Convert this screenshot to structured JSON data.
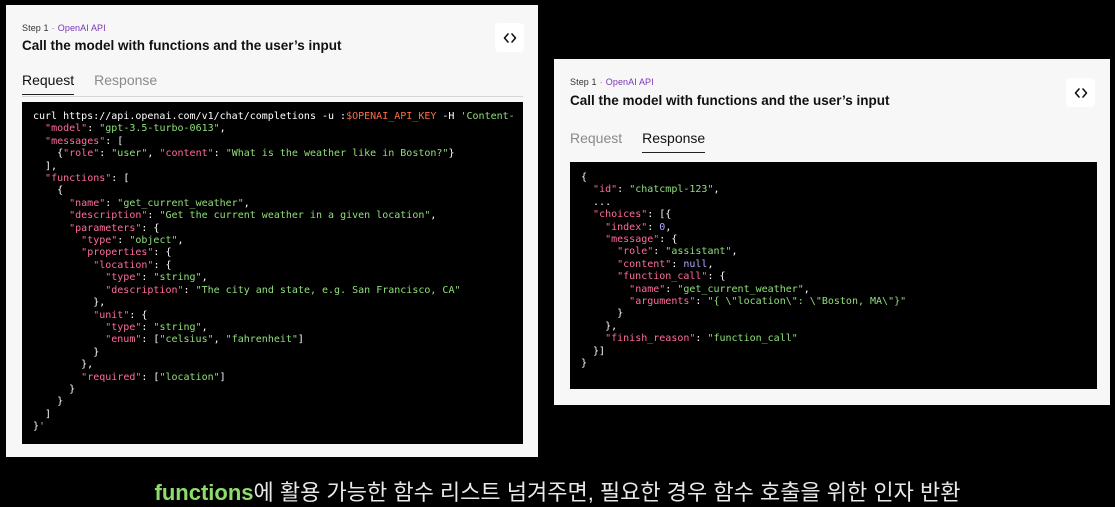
{
  "left_card": {
    "step": "Step 1",
    "step_source": "OpenAI API",
    "title": "Call the model with functions and the user’s input",
    "tabs": [
      {
        "label": "Request",
        "active": true
      },
      {
        "label": "Response",
        "active": false
      }
    ],
    "code_toggle_icon": "code-brackets-icon"
  },
  "right_card": {
    "step": "Step 1",
    "step_source": "OpenAI API",
    "title": "Call the model with functions and the user’s input",
    "tabs": [
      {
        "label": "Request",
        "active": false
      },
      {
        "label": "Response",
        "active": true
      }
    ],
    "code_toggle_icon": "code-brackets-icon"
  },
  "request_code": [
    "curl https://api.openai.com/v1/chat/completions -u :$OPENAI_API_KEY -H 'Content-",
    "  \"model\": \"gpt-3.5-turbo-0613\",",
    "  \"messages\": [",
    "    {\"role\": \"user\", \"content\": \"What is the weather like in Boston?\"}",
    "  ],",
    "  \"functions\": [",
    "    {",
    "      \"name\": \"get_current_weather\",",
    "      \"description\": \"Get the current weather in a given location\",",
    "      \"parameters\": {",
    "        \"type\": \"object\",",
    "        \"properties\": {",
    "          \"location\": {",
    "            \"type\": \"string\",",
    "            \"description\": \"The city and state, e.g. San Francisco, CA\"",
    "          },",
    "          \"unit\": {",
    "            \"type\": \"string\",",
    "            \"enum\": [\"celsius\", \"fahrenheit\"]",
    "          }",
    "        },",
    "        \"required\": [\"location\"]",
    "      }",
    "    }",
    "  ]",
    "}'"
  ],
  "response_code": [
    "{",
    "  \"id\": \"chatcmpl-123\",",
    "  ...",
    "  \"choices\": [{",
    "    \"index\": 0,",
    "    \"message\": {",
    "      \"role\": \"assistant\",",
    "      \"content\": null,",
    "      \"function_call\": {",
    "        \"name\": \"get_current_weather\",",
    "        \"arguments\": \"{ \\\"location\\\": \\\"Boston, MA\\\"}\"",
    "      }",
    "    },",
    "    \"finish_reason\": \"function_call\"",
    "  }]",
    "}"
  ],
  "caption": {
    "highlight": "functions",
    "rest": "에 활용 가능한 함수 리스트 넘겨주면, 필요한 경우 함수 호출을 위한 인자 반환"
  },
  "colors": {
    "card_bg": "#f7f7f8",
    "code_bg": "#000000",
    "string_green": "#8fe07a",
    "key_pink": "#ff6b9e",
    "env_var_orange": "#ff6b45",
    "api_purple": "#7a36b1",
    "caption_highlight": "#8edc6b"
  }
}
